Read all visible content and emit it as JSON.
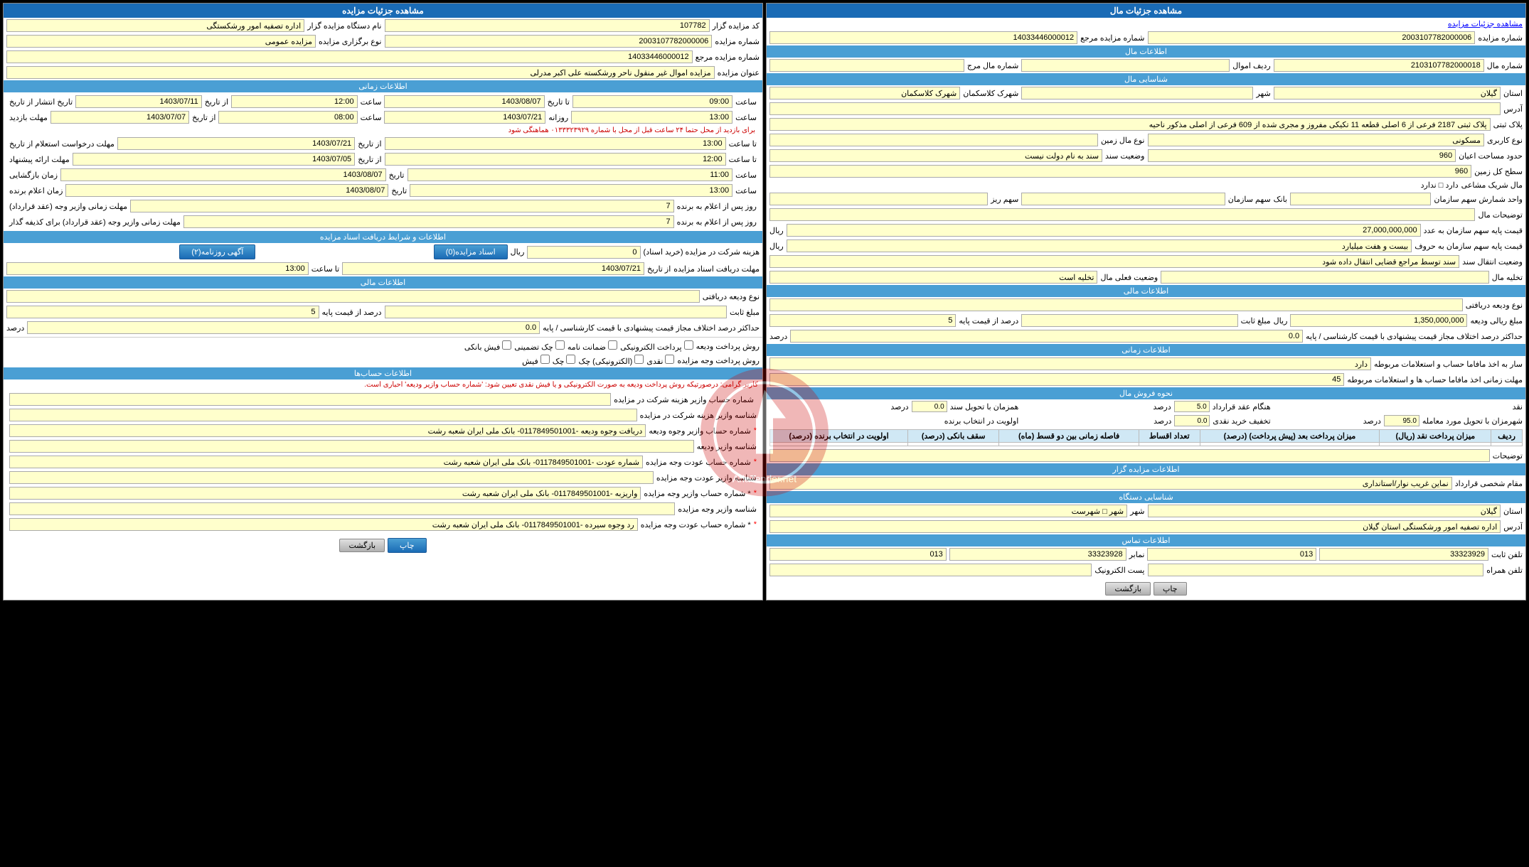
{
  "left_panel": {
    "main_title": "مشاهده جزئیات مال",
    "breadcrumb": "مشاهده جزئیات مزایده",
    "auction_ref_label": "شماره مزایده مرجع",
    "auction_ref_value": "14033446000012",
    "auction_num_label": "شماره مزایده",
    "auction_num_value": "2003107782000006",
    "financial_info_title": "اطلاعات مال",
    "mal_num_label": "شماره مال",
    "mal_num_value": "2103107782000018",
    "mal_row_label": "ردیف اموال",
    "mal_ref_label": "شماره مال مرج",
    "geo_title": "شناسایی مال",
    "ostan_label": "استان",
    "ostan_value": "گیلان",
    "shahr_label": "شهر",
    "shahr_value": "",
    "shahrk_label": "شهرک کلاسکمان",
    "adrs_label": "آدرس",
    "plak_label": "پلاک ثبتی",
    "plak_value": "پلاک ثبتی 2187 فرعی از 6 اصلی قطعه 11 تکیکی مفروز و مجری شده از 609 فرعی از اصلی مذکور ناحیه",
    "karbri_label": "نوع کاربری",
    "karbri_value": "مسکونی",
    "masahat_label": "حدود مساحت اعیان",
    "masahat_value": "960",
    "sanad_label": "وضعیت سند",
    "sanad_value": "سند به نام دولت نیست",
    "sath_label": "سطح کل زمین",
    "sath_value": "960",
    "mal_mashai_label": "مال شریک مشاعی",
    "mal_mashai_value": "دارد □ ندارد",
    "vazed_label": "واحد شمارش سهم سازمان",
    "bank_label": "بانک",
    "sahm_sazmn_label": "سهم سازمان",
    "sahm_riz_label": "سهم ریز",
    "tawzih_label": "توضیحات مال",
    "qimat_label": "قیمت پایه سهم سازمان به عدد",
    "qimat_value": "27,000,000,000",
    "qimat_unit": "ریال",
    "qimat2_label": "قیمت پایه سهم سازمان به حروف",
    "qimat2_value": "بیست و هفت میلیارد",
    "vazeat_label": "وضعیت انتقال سند",
    "vazeat_value": "سند توسط مراجع قضایی انتقال داده شود",
    "takhliyeh_label": "تخلیه مال",
    "takhliyeh_value": "وضعیت فعلی مال",
    "takhliyeh_value2": "تخلیه است",
    "financial_title": "اطلاعات مالی",
    "vadiyeh_label": "نوع ودیعه دریافتی",
    "mablagh_label": "مبلغ ریالی ودیعه",
    "mablagh_value": "1,350,000,000",
    "mablagh_unit": "ریال",
    "sabat_label": "مبلغ ثابت",
    "darsad_label": "درصد از قیمت پایه",
    "darsad_value": "5",
    "ekhtelaf_label": "حداکثر درصد اختلاف مجاز قیمت پیشنهادی با قیمت کارشناسی / پایه",
    "ekhtelaf_value": "0.0",
    "ekhtelaf_unit": "درصد",
    "zamani_title": "اطلاعات زمانی",
    "hesab_label": "سار به اخذ مافاما حساب و استعلامات مربوطه",
    "hesab_value": "دارد",
    "mohlat_label": "مهلت زمانی اخذ مافاما حساب ها و استعلامات مربوطه",
    "mohlat_value": "45",
    "forosh_title": "نحوه فروش مال",
    "naghd_label": "نقد",
    "oghd_label": "هنگام عقد قرارداد",
    "oghd_value": "5.0",
    "tahvil_sanad_label": "همزمان با تحویل سند",
    "tahvil_sanad_value": "0.0",
    "moamehleh_label": "شهرمزان با تحویل مورد معامله",
    "moamehleh_value": "95.0",
    "khrid_label": "تخفیف خرید نقدی",
    "khrid_value": "0.0",
    "avlviyat_label": "اولویت در انتخاب برنده",
    "table_headers": [
      "ردیف",
      "میزان پرداخت نقد (ریال)",
      "میزان پرداخت بعد (پیش پرداخت) (درصد)",
      "تعداد اقساط",
      "فاصله زمانی بین دو قسط (ماه)",
      "سقف بانکی (درصد)",
      "اولویت در انتخاب برنده (درصد)"
    ],
    "tozih_label": "توضیحات",
    "morabeheh_title": "اطلاعات مزایده گزار",
    "moghm_label": "مقام شخصی قرارداد",
    "moghm_value": "نماین غریب نوار/استانداری",
    "geo2_title": "شناسایی دستگاه",
    "ostan2_label": "استان",
    "ostan2_value": "گیلان",
    "shahr2_label": "شهر",
    "shahr2_value": "شهر □ شهرست",
    "adrs2_label": "آدرس",
    "adrs2_value": "اداره تصفیه امور ورشکستگی استان گیلان",
    "contact_title": "اطلاعات تماس",
    "tel_sabt_label": "تلفن ثابت",
    "tel_sabt_value": "33323929",
    "tel_code": "013",
    "fax_label": "نمابر",
    "fax_value": "33323928",
    "fax_code": "013",
    "tel_h_label": "تلفن همراه",
    "email_label": "پست الکترونیک",
    "btn_back": "بازگشت",
    "btn_print": "چاپ"
  },
  "right_panel": {
    "main_title": "مشاهده جزئیات مزایده",
    "kod_label": "کد مزایده گزار",
    "kod_value": "107782",
    "name_label": "نام دستگاه مزایده گزار",
    "name_value": "اداره تصفیه امور ورشکستگی",
    "noebargozari_label": "نوع برگزاری مزایده",
    "noebargozari_value": "مزایده عمومی",
    "shmareh_label": "شماره مزایده",
    "shmareh_value": "2003107782000006",
    "shmareh_mrj_label": "شماره مزایده مرجع",
    "shmareh_mrj_value": "14033446000012",
    "onvan_label": "عنوان مزایده",
    "onvan_value": "مزایده اموال غیر منقول ناحر ورشکسته علی اکبر مدرلی",
    "zamani_title": "اطلاعات زمانی",
    "tarikh_enteshar_label": "تاریخ انتشار از تاریخ",
    "tarikh_enteshar_from": "1403/07/11",
    "tarikh_enteshar_sa_from": "12:00",
    "tarikh_enteshar_to": "1403/08/07",
    "tarikh_enteshar_sa_to": "09:00",
    "mohlat_label": "مهلت بازدید",
    "mohlat_from": "1403/07/07",
    "mohlat_sa_from": "08:00",
    "mohlat_to": "1403/07/21",
    "mohlat_sa_to": "13:00",
    "arziyabi_label": "مهلت درخواست استعلام از تاریخ",
    "arziyabi_from": "1403/07/21",
    "arziyabi_sa_from": "13:00",
    "arziyabi_to": "",
    "arziyabi_sa_to": "",
    "erae_label": "مهلت ارائه پیشنهاد",
    "erae_from": "1403/07/05",
    "erae_sa_from": "12:00",
    "erae_to": "",
    "erae_sa_to": "",
    "bazazgoshaii_label": "زمان بازگشایی",
    "bazazgoshaii_date": "1403/08/07",
    "bazazgoshaii_sa": "11:00",
    "ealam_label": "زمان اعلام برنده",
    "ealam_date": "1403/08/07",
    "ealam_sa": "13:00",
    "mohlat_gharardad_label": "مهلت زمانی وازیر وجه (عقد قرارداد)",
    "mohlat_gharardad_value": "7",
    "mohlat_gharardad_unit": "روز پس از اعلام به برنده",
    "mohlat_vazirgozar_label": "مهلت زمانی وازیر وجه (عقد قرارداد) برای کذیفه گذار",
    "mohlat_vazirgozar_value": "7",
    "mohlat_vazirgozar_unit": "روز پس از اعلام به برنده",
    "asnad_title": "اطلاعات و شرایط دریافت اسناد مزایده",
    "horiynat_label": "هزینه شرکت در مزایده (خرید اسناد)",
    "horiynat_value": "0",
    "horiynat_unit": "ریال",
    "asnad_mozayedeh_btn": "اسناد مزایده(0)",
    "agahi_label": "آگهی روزنامه(۲)",
    "mohlat_asnad_label": "مهلت دریافت اسناد مزایده",
    "mohlat_asnad_from": "1403/07/21",
    "mohlat_asnad_sa_from": "13:00",
    "financial_title": "اطلاعات مالی",
    "vaziyat_label": "نوع ودیعه دریافتی",
    "sabt_label": "مبلغ ثابت",
    "darsad_label": "درصد از قیمت پایه",
    "darsad_value": "5",
    "ekhtelaf_label": "حداکثر درصد اختلاف مجاز قیمت پیشنهادی با قیمت کارشناسی / پایه",
    "ekhtelaf_value": "0.0",
    "ekhtelaf_unit": "درصد",
    "payment_label": "روش پرداخت ودیعه",
    "payment_options": [
      "پرداخت الکترونیکی",
      "ضمانت نامه",
      "چک تضمینی",
      "فیش بانکی"
    ],
    "payment2_label": "روش پرداخت وجه مزایده",
    "payment2_options": [
      "نقدی",
      "(الکترونیکی) چک",
      "چک",
      "فیش"
    ],
    "hesabha_title": "اطلاعات حساب‌ها",
    "note_text": "کاربر گرامی: درصورتیکه روش پرداخت ودیعه به صورت الکترونیکی و یا فیش نقدی تعیین شود: 'شماره حساب وازیر ودیعه' احباری است.",
    "hesab_rows": [
      {
        "label": "شماره حساب وازیر هزینه شرکت در مزایده",
        "value": ""
      },
      {
        "label": "شناسه وازیر هزینه شرکت در مزایده",
        "value": ""
      },
      {
        "label": "شماره حساب وازیر وجوه ودیعه",
        "value": "دریافت وجوه ودیعه -0117849501001- بانک ملی ایران شعبه رشت"
      },
      {
        "label": "شناسه وازیر ودیعه",
        "value": ""
      },
      {
        "label": "شماره حساب عودت وجه مزایده",
        "value": "شماره عودت -0117849501001- بانک ملی ایران شعبه رشت"
      },
      {
        "label": "شناسه وازیر عودت وجه مزایده",
        "value": ""
      },
      {
        "label": "* شماره حساب وازیر وجه مزایده",
        "value": "واریزبه -0117849501001- بانک ملی ایران شعبه رشت"
      },
      {
        "label": "شناسه وازیر وجه مزایده",
        "value": ""
      },
      {
        "label": "* شماره حساب عودت وجه مزایده",
        "value": "رد وجوه سیرده -0117849501001- بانک ملی ایران شعبه رشت"
      }
    ],
    "btn_print": "چاپ",
    "btn_back": "بازگشت"
  }
}
